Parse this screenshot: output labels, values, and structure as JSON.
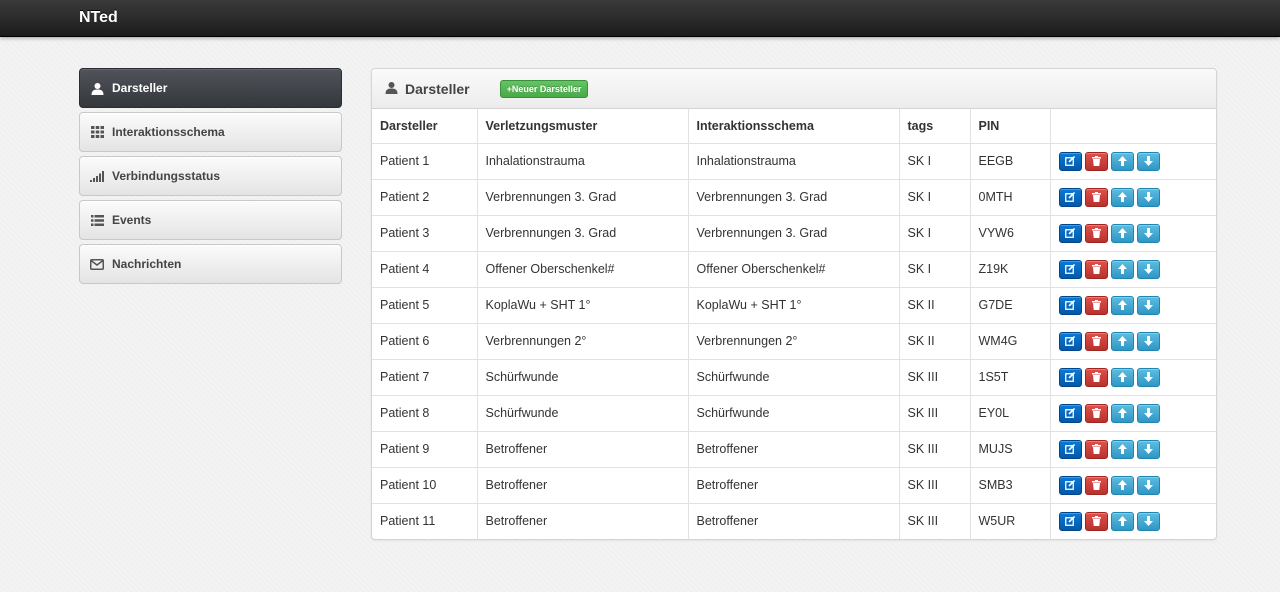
{
  "brand": "NTed",
  "sidebar": {
    "items": [
      {
        "label": "Darsteller",
        "icon": "user-icon"
      },
      {
        "label": "Interaktionsschema",
        "icon": "grid-icon"
      },
      {
        "label": "Verbindungsstatus",
        "icon": "signal-icon"
      },
      {
        "label": "Events",
        "icon": "list-icon"
      },
      {
        "label": "Nachrichten",
        "icon": "envelope-icon"
      }
    ]
  },
  "panel": {
    "title": "Darsteller",
    "new_button": "+Neuer Darsteller"
  },
  "table": {
    "columns": [
      "Darsteller",
      "Verletzungsmuster",
      "Interaktionsschema",
      "tags",
      "PIN",
      ""
    ],
    "rows": [
      [
        "Patient 1",
        "Inhalationstrauma",
        "Inhalationstrauma",
        "SK I",
        "EEGB"
      ],
      [
        "Patient 2",
        "Verbrennungen 3. Grad",
        "Verbrennungen 3. Grad",
        "SK I",
        "0MTH"
      ],
      [
        "Patient 3",
        "Verbrennungen 3. Grad",
        "Verbrennungen 3. Grad",
        "SK I",
        "VYW6"
      ],
      [
        "Patient 4",
        "Offener Oberschenkel#",
        "Offener Oberschenkel#",
        "SK I",
        "Z19K"
      ],
      [
        "Patient 5",
        "KoplaWu + SHT 1°",
        "KoplaWu + SHT 1°",
        "SK II",
        "G7DE"
      ],
      [
        "Patient 6",
        "Verbrennungen 2°",
        "Verbrennungen 2°",
        "SK II",
        "WM4G"
      ],
      [
        "Patient 7",
        "Schürfwunde",
        "Schürfwunde",
        "SK III",
        "1S5T"
      ],
      [
        "Patient 8",
        "Schürfwunde",
        "Schürfwunde",
        "SK III",
        "EY0L"
      ],
      [
        "Patient 9",
        "Betroffener",
        "Betroffener",
        "SK III",
        "MUJS"
      ],
      [
        "Patient 10",
        "Betroffener",
        "Betroffener",
        "SK III",
        "SMB3"
      ],
      [
        "Patient 11",
        "Betroffener",
        "Betroffener",
        "SK III",
        "W5UR"
      ]
    ],
    "row_actions": [
      "edit-icon",
      "trash-icon",
      "arrow-up-icon",
      "arrow-down-icon"
    ]
  },
  "colors": {
    "navbar": "#1c1c1c",
    "sidebar_active": "#3a3d42",
    "new_button": "#51b351",
    "edit": "#0560b8",
    "delete": "#cc3f3b",
    "move": "#3aa2d0"
  }
}
